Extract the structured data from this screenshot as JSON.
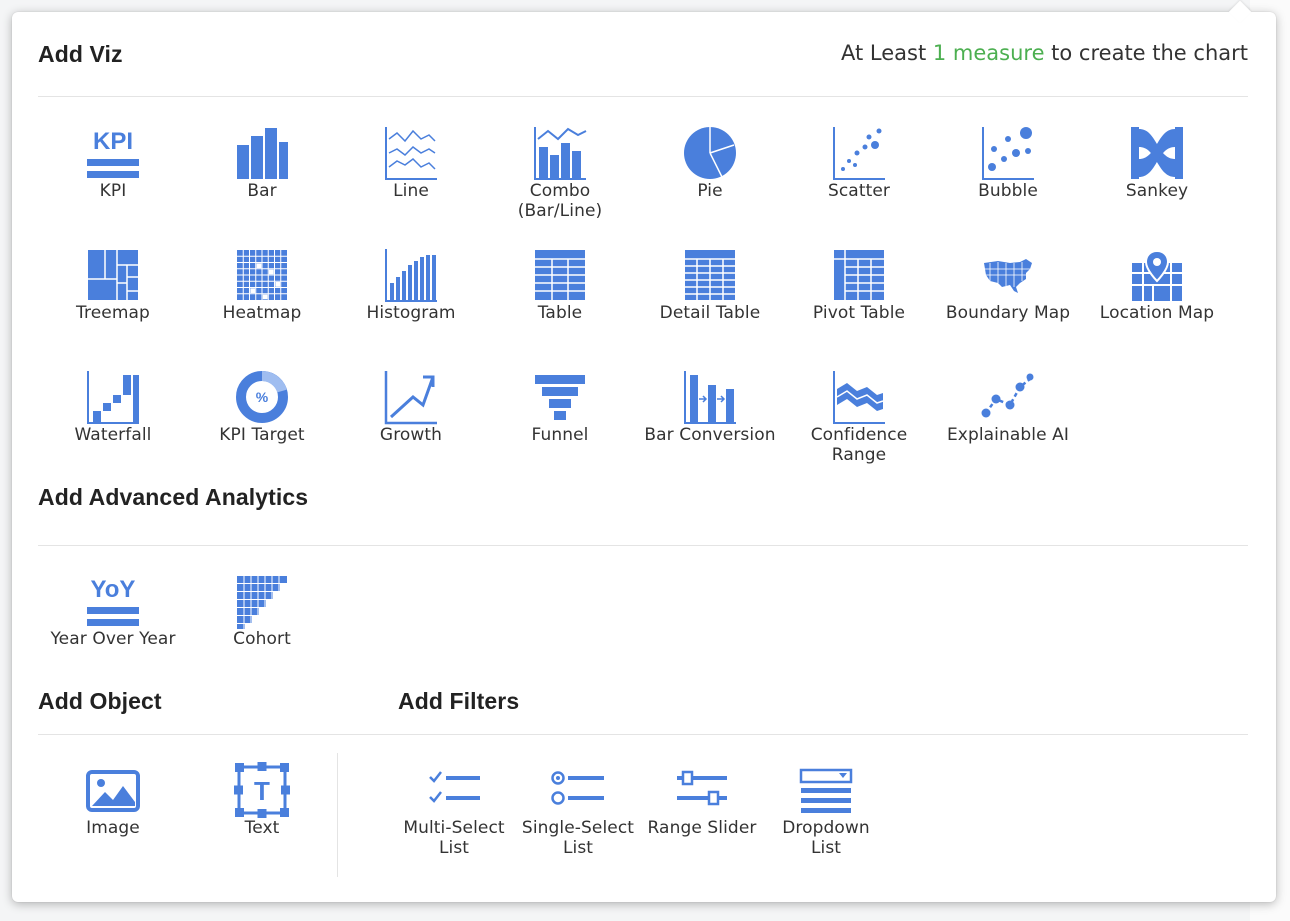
{
  "header": {
    "title": "Add Viz",
    "hint_prefix": "At Least ",
    "hint_accent": "1 measure",
    "hint_suffix": " to create the chart",
    "accent_color": "#4caf50",
    "icon_color": "#4a7fdc"
  },
  "viz": [
    {
      "label": "KPI",
      "icon": "kpi-icon"
    },
    {
      "label": "Bar",
      "icon": "bar-chart-icon"
    },
    {
      "label": "Line",
      "icon": "line-chart-icon"
    },
    {
      "label": "Combo\n(Bar/Line)",
      "icon": "combo-chart-icon"
    },
    {
      "label": "Pie",
      "icon": "pie-chart-icon"
    },
    {
      "label": "Scatter",
      "icon": "scatter-chart-icon"
    },
    {
      "label": "Bubble",
      "icon": "bubble-chart-icon"
    },
    {
      "label": "Sankey",
      "icon": "sankey-icon"
    },
    {
      "label": "Treemap",
      "icon": "treemap-icon"
    },
    {
      "label": "Heatmap",
      "icon": "heatmap-icon"
    },
    {
      "label": "Histogram",
      "icon": "histogram-icon"
    },
    {
      "label": "Table",
      "icon": "table-icon"
    },
    {
      "label": "Detail Table",
      "icon": "detail-table-icon"
    },
    {
      "label": "Pivot Table",
      "icon": "pivot-table-icon"
    },
    {
      "label": "Boundary Map",
      "icon": "boundary-map-icon"
    },
    {
      "label": "Location Map",
      "icon": "location-map-icon"
    },
    {
      "label": "Waterfall",
      "icon": "waterfall-icon"
    },
    {
      "label": "KPI Target",
      "icon": "kpi-target-icon"
    },
    {
      "label": "Growth",
      "icon": "growth-icon"
    },
    {
      "label": "Funnel",
      "icon": "funnel-icon"
    },
    {
      "label": "Bar Conversion",
      "icon": "bar-conversion-icon"
    },
    {
      "label": "Confidence\nRange",
      "icon": "confidence-range-icon"
    },
    {
      "label": "Explainable AI",
      "icon": "explainable-ai-icon"
    }
  ],
  "analytics": {
    "title": "Add Advanced Analytics",
    "items": [
      {
        "label": "Year Over Year",
        "icon": "yoy-icon"
      },
      {
        "label": "Cohort",
        "icon": "cohort-icon"
      }
    ]
  },
  "objects": {
    "title": "Add Object",
    "items": [
      {
        "label": "Image",
        "icon": "image-icon"
      },
      {
        "label": "Text",
        "icon": "text-icon"
      }
    ]
  },
  "filters": {
    "title": "Add Filters",
    "items": [
      {
        "label": "Multi-Select\nList",
        "icon": "multi-select-icon"
      },
      {
        "label": "Single-Select\nList",
        "icon": "single-select-icon"
      },
      {
        "label": "Range Slider",
        "icon": "range-slider-icon"
      },
      {
        "label": "Dropdown\nList",
        "icon": "dropdown-list-icon"
      }
    ]
  },
  "icon_text": {
    "kpi": "KPI",
    "yoy": "YoY",
    "percent": "%",
    "text_glyph": "T"
  }
}
